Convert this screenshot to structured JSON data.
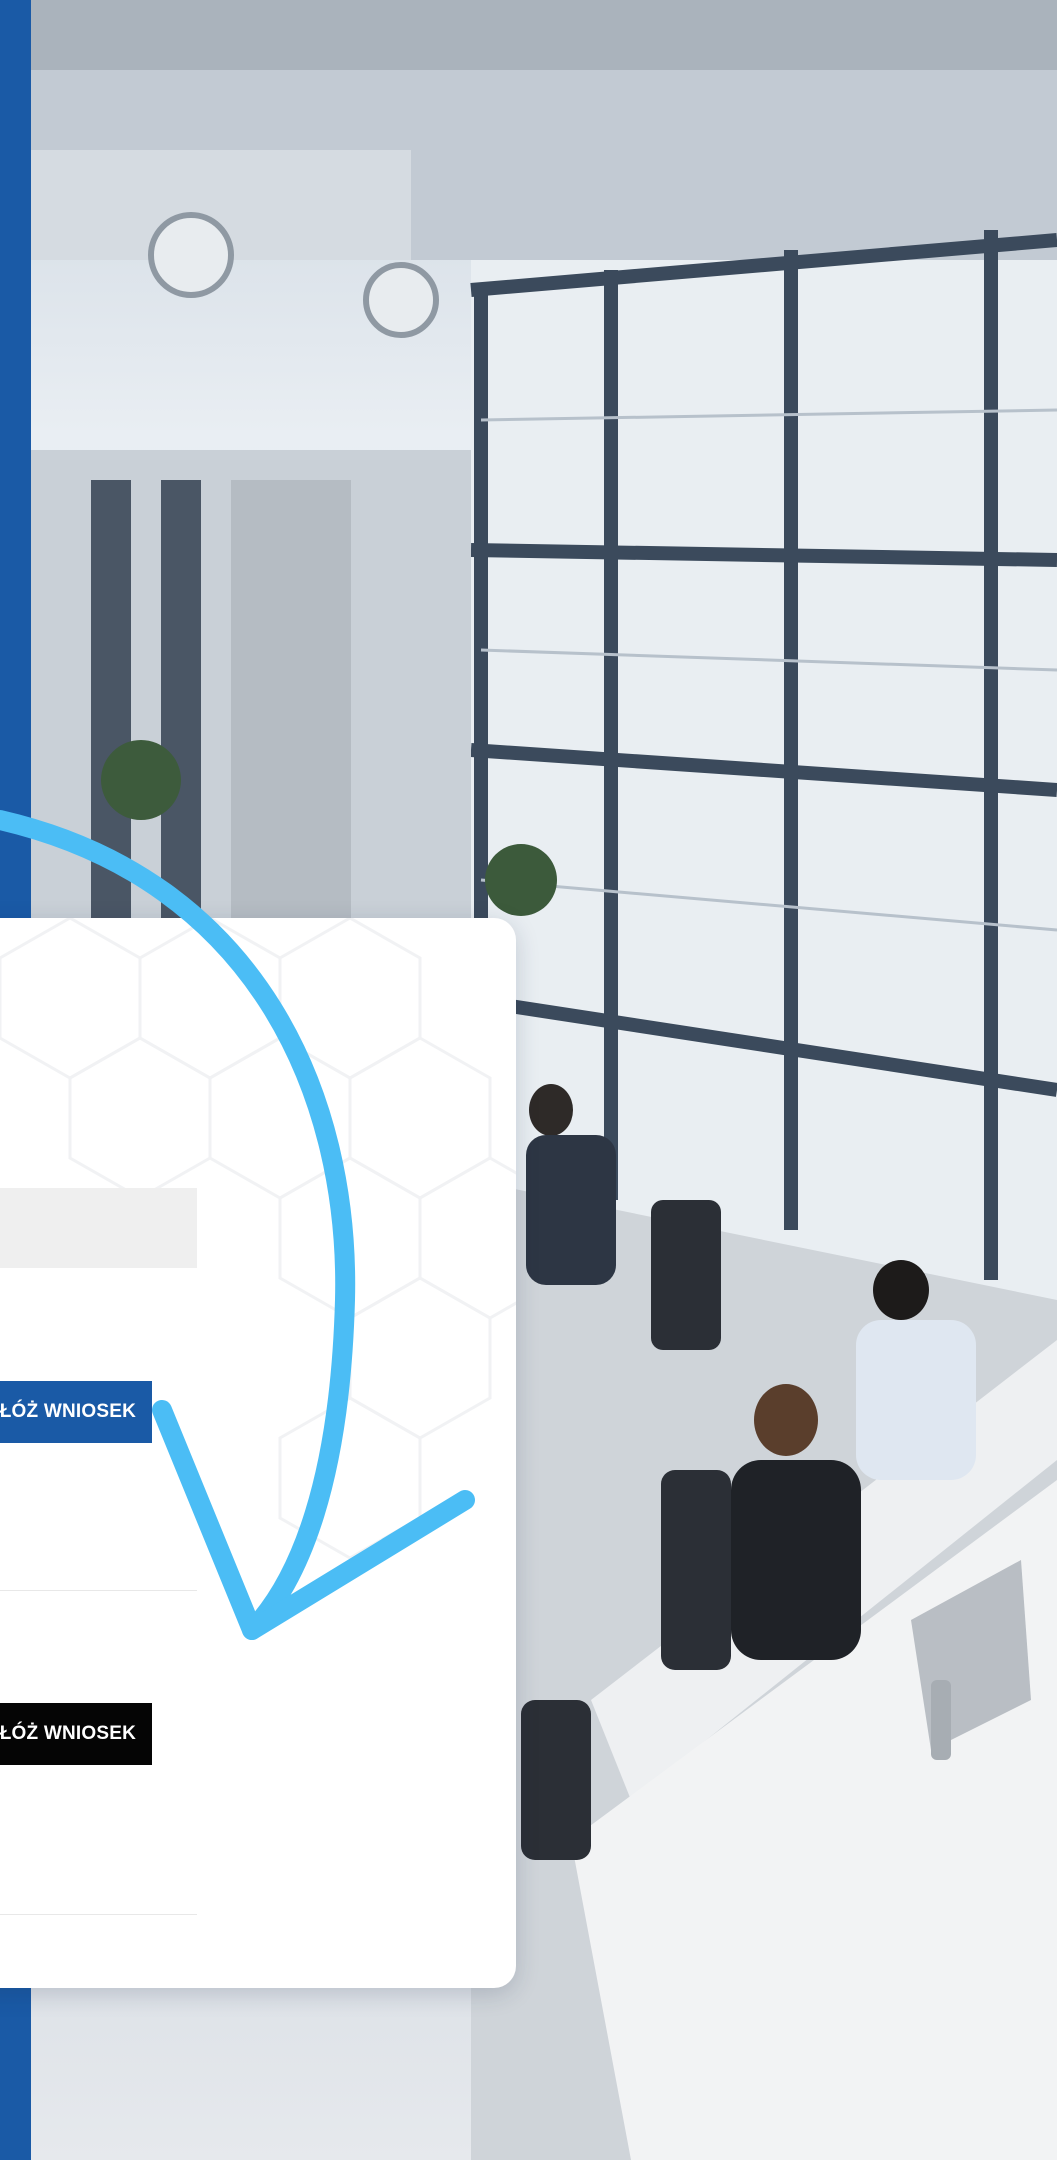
{
  "form": {
    "submit_button_1": "ŁÓŻ WNIOSEK",
    "submit_button_2": "ŁÓŻ WNIOSEK"
  },
  "colors": {
    "brand_blue": "#1a5aa6",
    "arrow_blue": "#4bbdf5",
    "button_black": "#050505",
    "card_bg": "#ffffff"
  },
  "icons": {
    "arrow": "curved-arrow-icon"
  }
}
